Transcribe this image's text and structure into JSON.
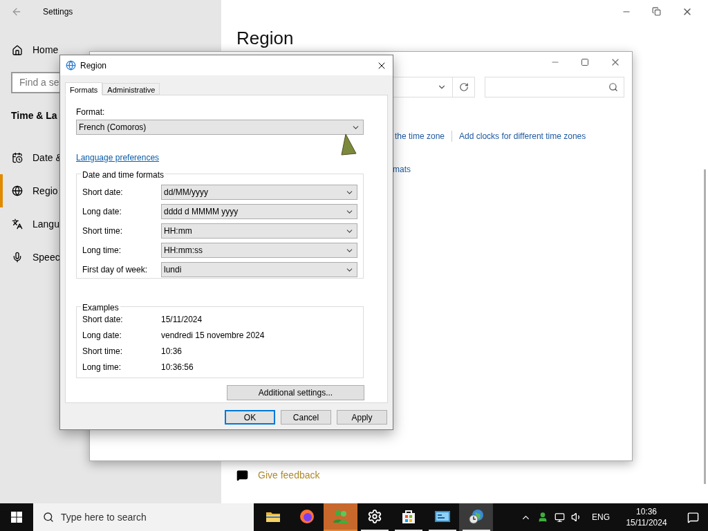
{
  "settings_window": {
    "title": "Settings",
    "nav": {
      "home": "Home",
      "search_placeholder": "Find a se",
      "section_title": "Time & La",
      "items": [
        {
          "label": "Date &",
          "kind": "calendar",
          "selected": false
        },
        {
          "label": "Regio",
          "kind": "region",
          "selected": true
        },
        {
          "label": "Langu",
          "kind": "language",
          "selected": false
        },
        {
          "label": "Speec",
          "kind": "speech",
          "selected": false
        }
      ]
    },
    "page_title": "Region",
    "feedback_link": "Give feedback"
  },
  "control_panel_window": {
    "links_row_1": [
      "the time zone",
      "Add clocks for different time zones"
    ],
    "links_row_2": [
      "mats"
    ]
  },
  "region_dialog": {
    "title": "Region",
    "tabs": [
      {
        "label": "Formats",
        "selected": true
      },
      {
        "label": "Administrative",
        "selected": false
      }
    ],
    "format": {
      "label": "Format:",
      "value": "French (Comoros)"
    },
    "language_link": "Language preferences",
    "formats_group": {
      "title": "Date and time formats",
      "rows": [
        {
          "label": "Short date:",
          "value": "dd/MM/yyyy"
        },
        {
          "label": "Long date:",
          "value": "dddd d MMMM yyyy"
        },
        {
          "label": "Short time:",
          "value": "HH:mm"
        },
        {
          "label": "Long time:",
          "value": "HH:mm:ss"
        },
        {
          "label": "First day of week:",
          "value": "lundi"
        }
      ]
    },
    "examples_group": {
      "title": "Examples",
      "rows": [
        {
          "label": "Short date:",
          "value": "15/11/2024"
        },
        {
          "label": "Long date:",
          "value": "vendredi 15 novembre 2024"
        },
        {
          "label": "Short time:",
          "value": "10:36"
        },
        {
          "label": "Long time:",
          "value": "10:36:56"
        }
      ]
    },
    "additional_button": "Additional settings...",
    "buttons": [
      {
        "label": "OK",
        "default": true
      },
      {
        "label": "Cancel",
        "default": false
      },
      {
        "label": "Apply",
        "default": false
      }
    ]
  },
  "taskbar": {
    "search_placeholder": "Type here to search",
    "apps": [
      {
        "kind": "explorer",
        "running": false,
        "active": false,
        "attention": false
      },
      {
        "kind": "firefox",
        "running": false,
        "active": false,
        "attention": false
      },
      {
        "kind": "people",
        "running": true,
        "active": false,
        "attention": true
      },
      {
        "kind": "settings",
        "running": true,
        "active": false,
        "attention": false
      },
      {
        "kind": "store",
        "running": true,
        "active": false,
        "attention": false
      },
      {
        "kind": "control-panel",
        "running": true,
        "active": false,
        "attention": false
      },
      {
        "kind": "region",
        "running": true,
        "active": true,
        "attention": false
      }
    ],
    "language": "ENG",
    "time": "10:36",
    "date": "15/11/2024"
  }
}
